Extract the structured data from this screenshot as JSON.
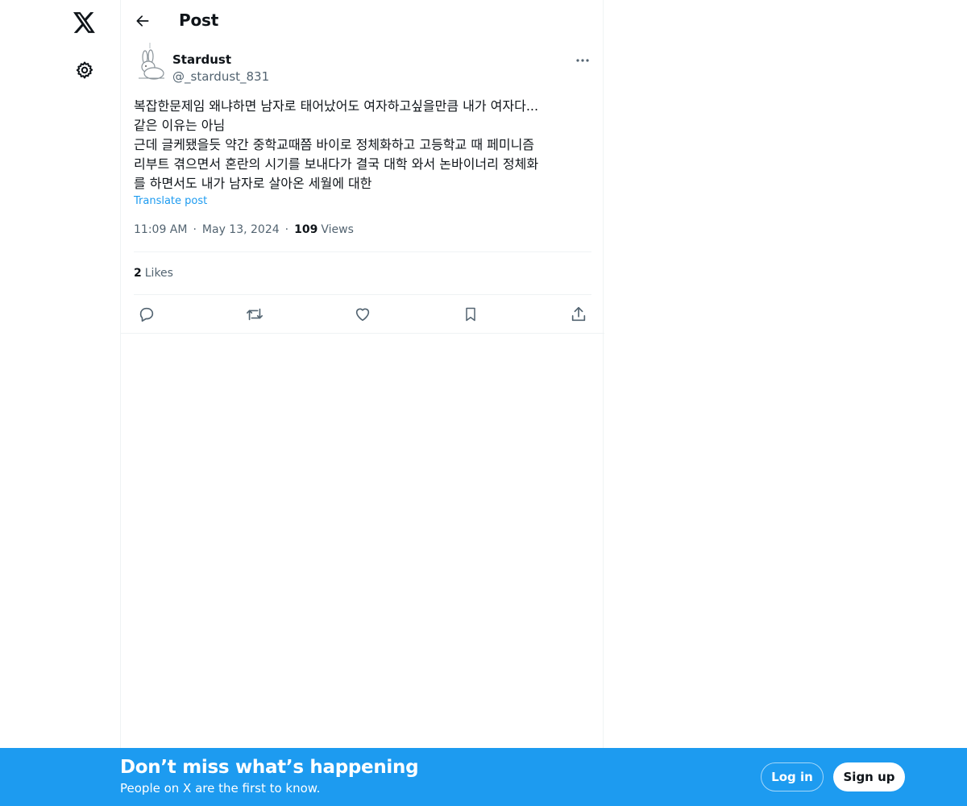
{
  "header": {
    "title": "Post"
  },
  "post": {
    "author_name": "Stardust",
    "author_handle": "@_stardust_831",
    "text_lines": [
      "복잡한문제임 왜냐하면 남자로 태어났어도 여자하고싶을만큼 내가 여자다...",
      "같은 이유는 아님",
      "근데 글케됐을듯 약간 중학교때쯤 바이로 정체화하고 고등학교 때 페미니즘",
      "리부트 겪으면서 혼란의 시기를 보내다가 결국 대학 와서 논바이너리 정체화",
      "를 하면서도 내가 남자로 살아온 세월에 대한"
    ],
    "translate_label": "Translate post",
    "time": "11:09 AM",
    "date": "May 13, 2024",
    "views_count": "109",
    "views_label": "Views",
    "meta_separator": "·",
    "likes_count": "2",
    "likes_label": "Likes"
  },
  "icons": {
    "logo": "x-logo-icon",
    "settings": "gear-icon",
    "back": "arrow-left-icon",
    "more": "more-horizontal-icon",
    "reply": "reply-icon",
    "repost": "repost-icon",
    "like": "heart-icon",
    "bookmark": "bookmark-icon",
    "share": "share-icon"
  },
  "banner": {
    "title": "Don’t miss what’s happening",
    "subtitle": "People on X are the first to know.",
    "login_label": "Log in",
    "signup_label": "Sign up"
  },
  "colors": {
    "accent": "#1d9bf0",
    "text_primary": "#0f1419",
    "text_secondary": "#536471",
    "border": "#eff3f4"
  }
}
